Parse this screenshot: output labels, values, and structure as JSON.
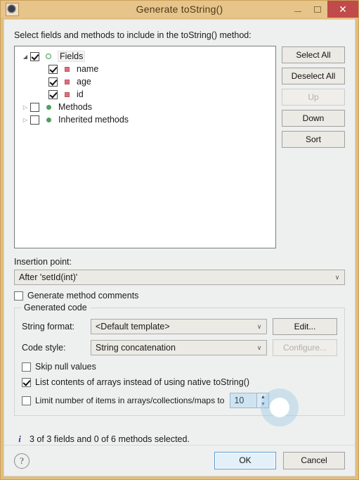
{
  "window": {
    "title": "Generate toString()",
    "app_icon": "eclipse-gear-icon",
    "minimize_label": "–",
    "maximize_label": "□",
    "close_label": "✕"
  },
  "intro_label": "Select fields and methods to include in the toString() method:",
  "tree": {
    "items": [
      {
        "label": "Fields",
        "checked": true,
        "indent": 0,
        "twisty": "◢",
        "icon": "package-field-icon",
        "selected": true
      },
      {
        "label": "name",
        "checked": true,
        "indent": 1,
        "twisty": "",
        "icon": "private-field-icon",
        "selected": false
      },
      {
        "label": "age",
        "checked": true,
        "indent": 1,
        "twisty": "",
        "icon": "private-field-icon",
        "selected": false
      },
      {
        "label": "id",
        "checked": true,
        "indent": 1,
        "twisty": "",
        "icon": "private-field-icon",
        "selected": false
      },
      {
        "label": "Methods",
        "checked": false,
        "indent": 0,
        "twisty": "▷",
        "icon": "public-method-icon",
        "selected": false
      },
      {
        "label": "Inherited methods",
        "checked": false,
        "indent": 0,
        "twisty": "▷",
        "icon": "public-method-icon",
        "selected": false
      }
    ]
  },
  "side_buttons": [
    {
      "label": "Select All",
      "disabled": false
    },
    {
      "label": "Deselect All",
      "disabled": false
    },
    {
      "label": "Up",
      "disabled": true
    },
    {
      "label": "Down",
      "disabled": false
    },
    {
      "label": "Sort",
      "disabled": false
    }
  ],
  "insertion_point": {
    "label": "Insertion point:",
    "value": "After 'setId(int)'",
    "arrow": "∨"
  },
  "generate_method_comments": {
    "label": "Generate method comments",
    "checked": false
  },
  "generated_code": {
    "title": "Generated code",
    "string_format": {
      "label": "String format:",
      "value": "<Default template>",
      "arrow": "∨",
      "button": "Edit...",
      "button_disabled": false
    },
    "code_style": {
      "label": "Code style:",
      "value": "String concatenation",
      "arrow": "∨",
      "button": "Configure...",
      "button_disabled": true
    },
    "skip_null": {
      "label": "Skip null values",
      "checked": false
    },
    "list_contents": {
      "label": "List contents of arrays instead of using native toString()",
      "checked": true
    },
    "limit_items": {
      "label": "Limit number of items in arrays/collections/maps to",
      "checked": false,
      "value": "10",
      "up_arrow": "▲",
      "down_arrow": "▼"
    }
  },
  "status": {
    "icon": "info-icon",
    "text": "3 of 3 fields and 0 of 6 methods selected."
  },
  "footer": {
    "help_label": "?",
    "ok_label": "OK",
    "cancel_label": "Cancel"
  },
  "colors": {
    "titlebar": "#e7c489",
    "frame": "#e3bd7e",
    "dialog_bg": "#eef0ef",
    "close_button": "#c14a4a",
    "default_button_border": "#5a9ccf",
    "info_text": "#2b3e8c",
    "spinner_highlight": "#cfe3f0"
  }
}
